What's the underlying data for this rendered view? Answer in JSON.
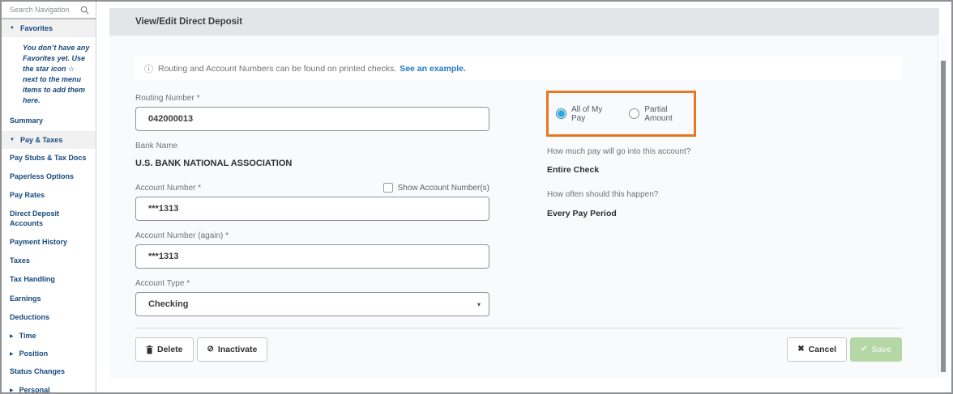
{
  "colors": {
    "accent_highlight": "#e87722",
    "radio_selected": "#29abe2",
    "link_blue": "#1f79c6",
    "save_green": "#b5d7a6",
    "sidebar_text": "#17497d"
  },
  "icons": {
    "search": "magnifier",
    "info": "ⓘ",
    "triangle_down": "▼",
    "triangle_right": "▶",
    "caret_down": "▾",
    "delete": "trash",
    "inactivate": "⊘",
    "cancel": "✖",
    "save": "✔",
    "favorites_star": "☆"
  },
  "sidebar": {
    "search": {
      "placeholder": "Search Navigation"
    },
    "items": [
      {
        "label": "Favorites",
        "type": "section-expanded"
      },
      {
        "label": "You don’t have any Favorites yet. Use the star icon ☆ next to the menu items to add them here.",
        "type": "note"
      },
      {
        "label": "Summary",
        "type": "link"
      },
      {
        "label": "Pay & Taxes",
        "type": "section-expanded"
      },
      {
        "label": "Pay Stubs & Tax Docs",
        "type": "link"
      },
      {
        "label": "Paperless Options",
        "type": "link"
      },
      {
        "label": "Pay Rates",
        "type": "link"
      },
      {
        "label": "Direct Deposit Accounts",
        "type": "link"
      },
      {
        "label": "Payment History",
        "type": "link"
      },
      {
        "label": "Taxes",
        "type": "link"
      },
      {
        "label": "Tax Handling",
        "type": "link"
      },
      {
        "label": "Earnings",
        "type": "link"
      },
      {
        "label": "Deductions",
        "type": "link"
      },
      {
        "label": "Time",
        "type": "section-collapsed"
      },
      {
        "label": "Position",
        "type": "section-collapsed"
      },
      {
        "label": "Status Changes",
        "type": "link"
      },
      {
        "label": "Personal",
        "type": "section-collapsed"
      }
    ]
  },
  "header": {
    "title": "View/Edit Direct Deposit"
  },
  "info_bar": {
    "text": "Routing and Account Numbers can be found on printed checks.",
    "link": "See an example."
  },
  "form": {
    "routing_number": {
      "label": "Routing Number *",
      "value": "042000013"
    },
    "bank_name": {
      "label": "Bank Name",
      "value": "U.S. BANK NATIONAL ASSOCIATION"
    },
    "account_number": {
      "label": "Account Number *",
      "value": "***1313"
    },
    "show_account_checkbox": {
      "label": "Show Account Number(s)",
      "checked": false
    },
    "account_number_again": {
      "label": "Account Number (again) *",
      "value": "***1313"
    },
    "account_type": {
      "label": "Account Type *",
      "value": "Checking"
    }
  },
  "deposit_options": {
    "radio_all": {
      "label": "All of My Pay",
      "selected": true
    },
    "radio_partial": {
      "label": "Partial Amount",
      "selected": false
    },
    "question_amount": "How much pay will go into this account?",
    "answer_amount": "Entire Check",
    "question_frequency": "How often should this happen?",
    "answer_frequency": "Every Pay Period"
  },
  "footer": {
    "delete_label": "Delete",
    "inactivate_label": "Inactivate",
    "cancel_label": "Cancel",
    "save_label": "Save"
  }
}
